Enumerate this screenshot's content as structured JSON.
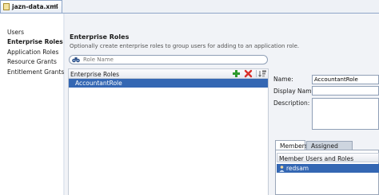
{
  "file_tab": {
    "name": "jazn-data.xml",
    "close": "×"
  },
  "sidebar": {
    "items": [
      {
        "label": "Users"
      },
      {
        "label": "Enterprise Roles"
      },
      {
        "label": "Application Roles"
      },
      {
        "label": "Resource Grants"
      },
      {
        "label": "Entitlement Grants"
      }
    ],
    "selected": "Enterprise Roles"
  },
  "main": {
    "title": "Enterprise Roles",
    "subtitle": "Optionally create enterprise roles to group users for adding to an application role.",
    "search": {
      "placeholder": "Role Name",
      "value": ""
    },
    "list_header": "Enterprise Roles",
    "roles": [
      "AccountantRole"
    ],
    "selected_role": "AccountantRole"
  },
  "details": {
    "name_label": "Name:",
    "name_value": "AccountantRole",
    "display_name_label": "Display Name:",
    "display_name_value": "",
    "description_label": "Description:",
    "description_value": "",
    "tabs": [
      {
        "label": "Members"
      },
      {
        "label": "Assigned Roles"
      }
    ],
    "active_tab": "Members",
    "members_header": "Member Users and Roles",
    "members": [
      "redsam"
    ]
  },
  "colors": {
    "selection": "#3467b3",
    "panel_bg": "#f1f3f7",
    "add_icon": "#2e9a2e",
    "delete_icon": "#d9302a"
  },
  "icons": {
    "search": "binoculars-icon",
    "add": "plus-icon",
    "delete": "x-icon",
    "sort": "sort-icon",
    "member": "user-icon"
  }
}
